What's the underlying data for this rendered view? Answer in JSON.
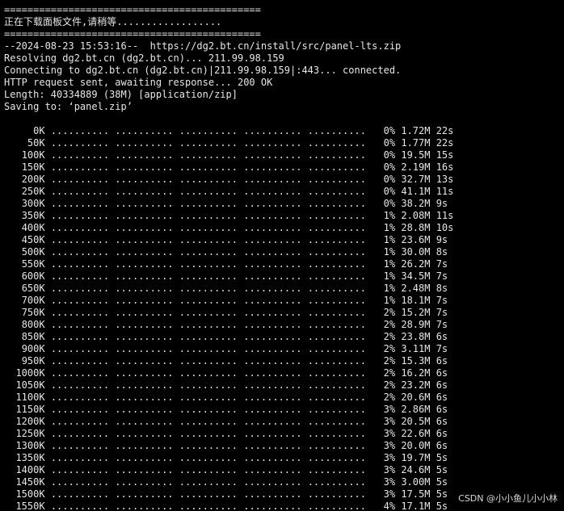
{
  "header": {
    "rule_top": "============================================",
    "message": "正在下载面板文件,请稍等..................",
    "rule_bottom": "============================================"
  },
  "wget": {
    "start_line": "--2024-08-23 15:53:16--  https://dg2.bt.cn/install/src/panel-lts.zip",
    "resolving": "Resolving dg2.bt.cn (dg2.bt.cn)... 211.99.98.159",
    "connecting": "Connecting to dg2.bt.cn (dg2.bt.cn)|211.99.98.159|:443... connected.",
    "http_status": "HTTP request sent, awaiting response... 200 OK",
    "length": "Length: 40334889 (38M) [application/zip]",
    "saving": "Saving to: ‘panel.zip’"
  },
  "progress_rows": [
    {
      "offset": "0K",
      "percent": "0%",
      "speed": "1.72M",
      "eta": "22s"
    },
    {
      "offset": "50K",
      "percent": "0%",
      "speed": "1.77M",
      "eta": "22s"
    },
    {
      "offset": "100K",
      "percent": "0%",
      "speed": "19.5M",
      "eta": "15s"
    },
    {
      "offset": "150K",
      "percent": "0%",
      "speed": "2.19M",
      "eta": "16s"
    },
    {
      "offset": "200K",
      "percent": "0%",
      "speed": "32.7M",
      "eta": "13s"
    },
    {
      "offset": "250K",
      "percent": "0%",
      "speed": "41.1M",
      "eta": "11s"
    },
    {
      "offset": "300K",
      "percent": "0%",
      "speed": "38.2M",
      "eta": "9s"
    },
    {
      "offset": "350K",
      "percent": "1%",
      "speed": "2.08M",
      "eta": "11s"
    },
    {
      "offset": "400K",
      "percent": "1%",
      "speed": "28.8M",
      "eta": "10s"
    },
    {
      "offset": "450K",
      "percent": "1%",
      "speed": "23.6M",
      "eta": "9s"
    },
    {
      "offset": "500K",
      "percent": "1%",
      "speed": "30.0M",
      "eta": "8s"
    },
    {
      "offset": "550K",
      "percent": "1%",
      "speed": "26.2M",
      "eta": "7s"
    },
    {
      "offset": "600K",
      "percent": "1%",
      "speed": "34.5M",
      "eta": "7s"
    },
    {
      "offset": "650K",
      "percent": "1%",
      "speed": "2.48M",
      "eta": "8s"
    },
    {
      "offset": "700K",
      "percent": "1%",
      "speed": "18.1M",
      "eta": "7s"
    },
    {
      "offset": "750K",
      "percent": "2%",
      "speed": "15.2M",
      "eta": "7s"
    },
    {
      "offset": "800K",
      "percent": "2%",
      "speed": "28.9M",
      "eta": "7s"
    },
    {
      "offset": "850K",
      "percent": "2%",
      "speed": "23.8M",
      "eta": "6s"
    },
    {
      "offset": "900K",
      "percent": "2%",
      "speed": "3.11M",
      "eta": "7s"
    },
    {
      "offset": "950K",
      "percent": "2%",
      "speed": "15.3M",
      "eta": "6s"
    },
    {
      "offset": "1000K",
      "percent": "2%",
      "speed": "16.2M",
      "eta": "6s"
    },
    {
      "offset": "1050K",
      "percent": "2%",
      "speed": "23.2M",
      "eta": "6s"
    },
    {
      "offset": "1100K",
      "percent": "2%",
      "speed": "20.6M",
      "eta": "6s"
    },
    {
      "offset": "1150K",
      "percent": "3%",
      "speed": "2.86M",
      "eta": "6s"
    },
    {
      "offset": "1200K",
      "percent": "3%",
      "speed": "20.5M",
      "eta": "6s"
    },
    {
      "offset": "1250K",
      "percent": "3%",
      "speed": "22.6M",
      "eta": "6s"
    },
    {
      "offset": "1300K",
      "percent": "3%",
      "speed": "20.0M",
      "eta": "6s"
    },
    {
      "offset": "1350K",
      "percent": "3%",
      "speed": "19.7M",
      "eta": "5s"
    },
    {
      "offset": "1400K",
      "percent": "3%",
      "speed": "24.6M",
      "eta": "5s"
    },
    {
      "offset": "1450K",
      "percent": "3%",
      "speed": "3.00M",
      "eta": "5s"
    },
    {
      "offset": "1500K",
      "percent": "3%",
      "speed": "17.5M",
      "eta": "5s"
    },
    {
      "offset": "1550K",
      "percent": "4%",
      "speed": "17.1M",
      "eta": "5s"
    }
  ],
  "progress_dots": ".......... .......... .......... .......... ..........",
  "watermark": "CSDN @小小鱼儿小小林"
}
